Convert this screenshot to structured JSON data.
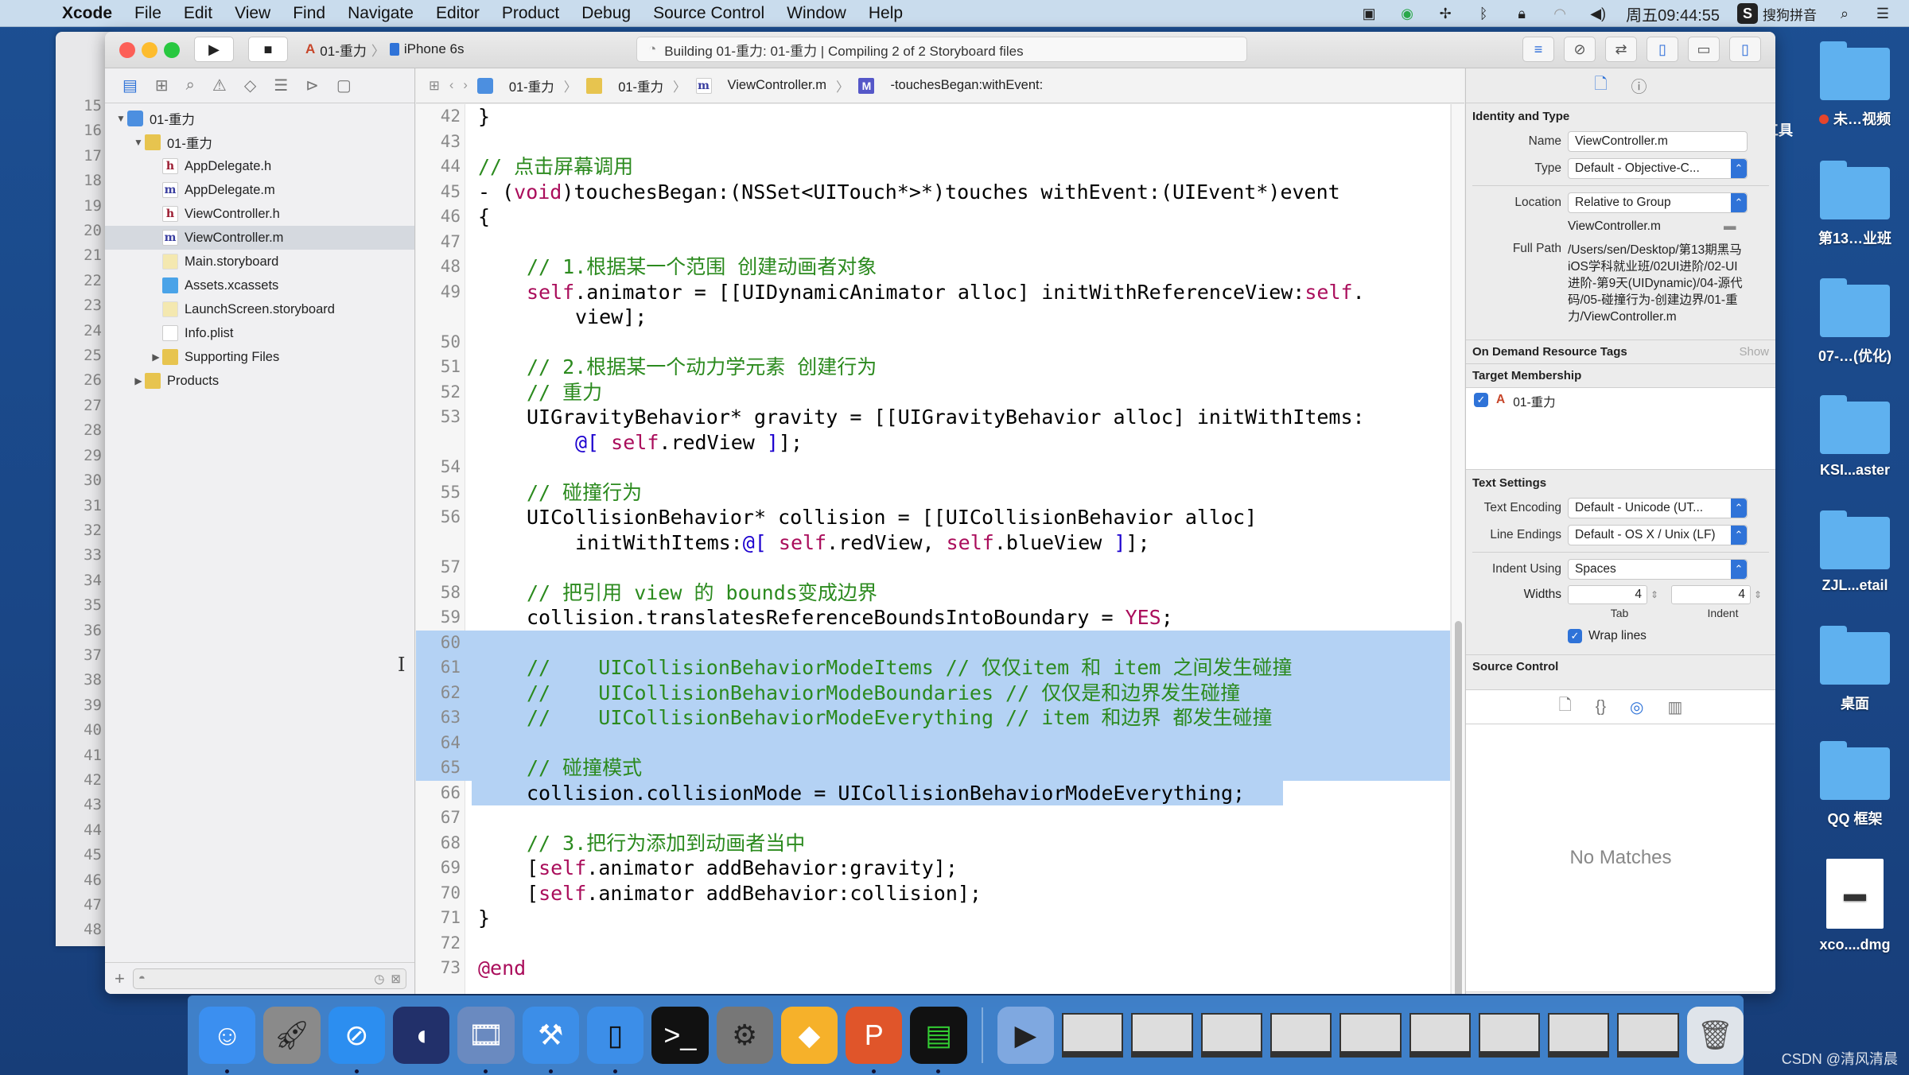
{
  "menubar": {
    "app": "Xcode",
    "items": [
      "File",
      "Edit",
      "View",
      "Find",
      "Navigate",
      "Editor",
      "Product",
      "Debug",
      "Source Control",
      "Window",
      "Help"
    ],
    "clock": "周五09:44:55",
    "input_method": "搜狗拼音",
    "status_icons": [
      "screen-record-icon",
      "play-circle-icon",
      "fan-icon",
      "bluetooth-icon",
      "lock-icon",
      "wifi-icon",
      "volume-icon"
    ]
  },
  "toolbar": {
    "scheme_target": "01-重力",
    "scheme_device": "iPhone 6s",
    "activity": "Building 01-重力: 01-重力  |  Compiling 2 of 2 Storyboard files"
  },
  "back_window": {
    "line_numbers": [
      "15",
      "16",
      "17",
      "18",
      "19",
      "20",
      "21",
      "22",
      "23",
      "24",
      "25",
      "26",
      "27",
      "28",
      "29",
      "30",
      "31",
      "32",
      "33",
      "34",
      "35",
      "36",
      "37",
      "38",
      "39",
      "40",
      "41",
      "42",
      "43",
      "44",
      "45",
      "46",
      "47",
      "48"
    ]
  },
  "navigator": {
    "tree": [
      {
        "label": "01-重力",
        "icon": "project",
        "depth": 0,
        "disclosure": "open"
      },
      {
        "label": "01-重力",
        "icon": "folder",
        "depth": 1,
        "disclosure": "open"
      },
      {
        "label": "AppDelegate.h",
        "icon": "h",
        "depth": 2
      },
      {
        "label": "AppDelegate.m",
        "icon": "m",
        "depth": 2
      },
      {
        "label": "ViewController.h",
        "icon": "h",
        "depth": 2
      },
      {
        "label": "ViewController.m",
        "icon": "m",
        "depth": 2,
        "selected": true
      },
      {
        "label": "Main.storyboard",
        "icon": "storyboard",
        "depth": 2
      },
      {
        "label": "Assets.xcassets",
        "icon": "assets",
        "depth": 2
      },
      {
        "label": "LaunchScreen.storyboard",
        "icon": "storyboard",
        "depth": 2
      },
      {
        "label": "Info.plist",
        "icon": "plist",
        "depth": 2
      },
      {
        "label": "Supporting Files",
        "icon": "folder",
        "depth": 2,
        "disclosure": "closed"
      },
      {
        "label": "Products",
        "icon": "folder",
        "depth": 1,
        "disclosure": "closed"
      }
    ]
  },
  "jumpbar": {
    "crumbs": [
      "01-重力",
      "01-重力",
      "ViewController.m",
      "-touchesBegan:withEvent:"
    ]
  },
  "editor": {
    "lines": [
      {
        "n": "42",
        "indent": 0,
        "parts": [
          [
            "p",
            "}"
          ]
        ]
      },
      {
        "n": "43",
        "indent": 0,
        "parts": []
      },
      {
        "n": "44",
        "indent": 0,
        "parts": [
          [
            "c",
            "// 点击屏幕调用"
          ]
        ]
      },
      {
        "n": "45",
        "indent": 0,
        "parts": [
          [
            "p",
            "- ("
          ],
          [
            "k",
            "void"
          ],
          [
            "p",
            ")touchesBegan:(NSSet<UITouch*>*)touches withEvent:(UIEvent*)event"
          ]
        ]
      },
      {
        "n": "46",
        "indent": 0,
        "parts": [
          [
            "p",
            "{"
          ]
        ]
      },
      {
        "n": "47",
        "indent": 0,
        "parts": []
      },
      {
        "n": "48",
        "indent": 1,
        "parts": [
          [
            "c",
            "// 1.根据某一个范围 创建动画者对象"
          ]
        ]
      },
      {
        "n": "49",
        "indent": 1,
        "parts": [
          [
            "k",
            "self"
          ],
          [
            "p",
            ".animator = [[UIDynamicAnimator alloc] initWithReferenceView:"
          ],
          [
            "k",
            "self"
          ],
          [
            "p",
            "."
          ]
        ]
      },
      {
        "n": "",
        "indent": 2,
        "parts": [
          [
            "p",
            "view];"
          ]
        ]
      },
      {
        "n": "50",
        "indent": 0,
        "parts": []
      },
      {
        "n": "51",
        "indent": 1,
        "parts": [
          [
            "c",
            "// 2.根据某一个动力学元素 创建行为"
          ]
        ]
      },
      {
        "n": "52",
        "indent": 1,
        "parts": [
          [
            "c",
            "// 重力"
          ]
        ]
      },
      {
        "n": "53",
        "indent": 1,
        "parts": [
          [
            "p",
            "UIGravityBehavior* gravity = [[UIGravityBehavior alloc] initWithItems:"
          ]
        ]
      },
      {
        "n": "",
        "indent": 2,
        "parts": [
          [
            "n",
            "@["
          ],
          [
            "p",
            " "
          ],
          [
            "k",
            "self"
          ],
          [
            "p",
            ".redView "
          ],
          [
            "n",
            "]"
          ],
          [
            "p",
            "];"
          ]
        ]
      },
      {
        "n": "54",
        "indent": 0,
        "parts": []
      },
      {
        "n": "55",
        "indent": 1,
        "parts": [
          [
            "c",
            "// 碰撞行为"
          ]
        ]
      },
      {
        "n": "56",
        "indent": 1,
        "parts": [
          [
            "p",
            "UICollisionBehavior* collision = [[UICollisionBehavior alloc]"
          ]
        ]
      },
      {
        "n": "",
        "indent": 2,
        "parts": [
          [
            "p",
            "initWithItems:"
          ],
          [
            "n",
            "@["
          ],
          [
            "p",
            " "
          ],
          [
            "k",
            "self"
          ],
          [
            "p",
            ".redView, "
          ],
          [
            "k",
            "self"
          ],
          [
            "p",
            ".blueView "
          ],
          [
            "n",
            "]"
          ],
          [
            "p",
            "];"
          ]
        ]
      },
      {
        "n": "57",
        "indent": 0,
        "parts": []
      },
      {
        "n": "58",
        "indent": 1,
        "parts": [
          [
            "c",
            "// 把引用 view 的 bounds变成边界"
          ]
        ]
      },
      {
        "n": "59",
        "indent": 1,
        "parts": [
          [
            "p",
            "collision.translatesReferenceBoundsIntoBoundary = "
          ],
          [
            "k",
            "YES"
          ],
          [
            "p",
            ";"
          ]
        ]
      },
      {
        "n": "60",
        "indent": 0,
        "parts": [],
        "hl": true
      },
      {
        "n": "61",
        "indent": 1,
        "parts": [
          [
            "c",
            "//    UICollisionBehaviorModeItems // 仅仅item 和 item 之间发生碰撞"
          ]
        ],
        "hl": true
      },
      {
        "n": "62",
        "indent": 1,
        "parts": [
          [
            "c",
            "//    UICollisionBehaviorModeBoundaries // 仅仅是和边界发生碰撞"
          ]
        ],
        "hl": true
      },
      {
        "n": "63",
        "indent": 1,
        "parts": [
          [
            "c",
            "//    UICollisionBehaviorModeEverything // item 和边界 都发生碰撞"
          ]
        ],
        "hl": true
      },
      {
        "n": "64",
        "indent": 0,
        "parts": [],
        "hl": true
      },
      {
        "n": "65",
        "indent": 1,
        "parts": [
          [
            "c",
            "// 碰撞模式"
          ]
        ],
        "hl": true
      },
      {
        "n": "66",
        "indent": 1,
        "parts": [
          [
            "p",
            "collision.collisionMode = UICollisionBehaviorModeEverything;"
          ]
        ],
        "hlpart": true
      },
      {
        "n": "67",
        "indent": 0,
        "parts": []
      },
      {
        "n": "68",
        "indent": 1,
        "parts": [
          [
            "c",
            "// 3.把行为添加到动画者当中"
          ]
        ]
      },
      {
        "n": "69",
        "indent": 1,
        "parts": [
          [
            "p",
            "["
          ],
          [
            "k",
            "self"
          ],
          [
            "p",
            ".animator addBehavior:gravity];"
          ]
        ]
      },
      {
        "n": "70",
        "indent": 1,
        "parts": [
          [
            "p",
            "["
          ],
          [
            "k",
            "self"
          ],
          [
            "p",
            ".animator addBehavior:collision];"
          ]
        ]
      },
      {
        "n": "71",
        "indent": 0,
        "parts": [
          [
            "p",
            "}"
          ]
        ]
      },
      {
        "n": "72",
        "indent": 0,
        "parts": []
      },
      {
        "n": "73",
        "indent": 0,
        "parts": [
          [
            "k",
            "@end"
          ]
        ]
      }
    ]
  },
  "inspector": {
    "identity_header": "Identity and Type",
    "name_label": "Name",
    "name_value": "ViewController.m",
    "type_label": "Type",
    "type_value": "Default - Objective-C...",
    "location_label": "Location",
    "location_value": "Relative to Group",
    "location_file": "ViewController.m",
    "fullpath_label": "Full Path",
    "fullpath_value": "/Users/sen/Desktop/第13期黑马iOS学科就业班/02UI进阶/02-UI进阶-第9天(UIDynamic)/04-源代码/05-碰撞行为-创建边界/01-重力/ViewController.m",
    "odr_header": "On Demand Resource Tags",
    "odr_show": "Show",
    "target_header": "Target Membership",
    "target_name": "01-重力",
    "target_checked": true,
    "text_header": "Text Settings",
    "encoding_label": "Text Encoding",
    "encoding_value": "Default - Unicode (UT...",
    "endings_label": "Line Endings",
    "endings_value": "Default - OS X / Unix (LF)",
    "indent_label": "Indent Using",
    "indent_value": "Spaces",
    "widths_label": "Widths",
    "tab_width": "4",
    "indent_width": "4",
    "tab_caption": "Tab",
    "indent_caption": "Indent",
    "wrap_label": "Wrap lines",
    "wrap_checked": true,
    "sc_header": "Source Control",
    "library_empty": "No Matches"
  },
  "desktop": {
    "partial_labels": [
      "工具"
    ],
    "icons": [
      {
        "label": "未…视频",
        "tag": "red"
      },
      {
        "label": "第13…业班"
      },
      {
        "label": "07-…(优化)"
      },
      {
        "label": "KSI...aster"
      },
      {
        "label": "ZJL...etail"
      },
      {
        "label": "桌面"
      },
      {
        "label": "QQ 框架"
      },
      {
        "label": "xco....dmg",
        "kind": "dmg"
      }
    ]
  },
  "dock": {
    "apps": [
      "finder-icon",
      "launchpad-icon",
      "safari-icon",
      "mouse-app-icon",
      "video-app-icon",
      "xcode-icon",
      "simulator-icon",
      "terminal-icon",
      "system-preferences-icon",
      "sketch-icon",
      "powerpoint-like-icon",
      "console-icon"
    ],
    "running": [
      true,
      false,
      true,
      false,
      true,
      true,
      true,
      false,
      false,
      false,
      true,
      true
    ],
    "thumbnails": 9
  },
  "watermark": "CSDN @清风清晨"
}
